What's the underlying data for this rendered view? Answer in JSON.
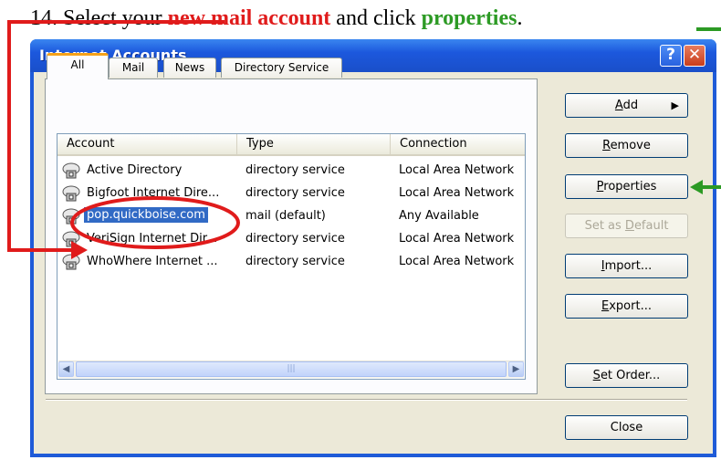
{
  "caption": {
    "prefix": "14. Select your ",
    "highlight1": "new mail account",
    "middle": " and click ",
    "highlight2": "properties",
    "suffix": "."
  },
  "window": {
    "title": "Internet Accounts",
    "help_glyph": "?",
    "close_glyph": "✕"
  },
  "tabs": [
    "All",
    "Mail",
    "News",
    "Directory Service"
  ],
  "columns": [
    "Account",
    "Type",
    "Connection"
  ],
  "accounts": [
    {
      "name": "Active Directory",
      "type": "directory service",
      "connection": "Local Area Network"
    },
    {
      "name": "Bigfoot Internet Dire...",
      "type": "directory service",
      "connection": "Local Area Network"
    },
    {
      "name": "pop.quickboise.com",
      "type": "mail (default)",
      "connection": "Any Available"
    },
    {
      "name": "VeriSign Internet Dir...",
      "type": "directory service",
      "connection": "Local Area Network"
    },
    {
      "name": "WhoWhere Internet ...",
      "type": "directory service",
      "connection": "Local Area Network"
    }
  ],
  "selected_account": "pop.quickboise.com",
  "buttons": {
    "add": {
      "mnemonic": "A",
      "rest": "dd"
    },
    "remove": {
      "mnemonic": "R",
      "rest": "emove"
    },
    "properties": {
      "mnemonic": "P",
      "rest": "roperties"
    },
    "set_default": {
      "before": "Set as ",
      "mnemonic": "D",
      "rest": "efault"
    },
    "import": {
      "mnemonic": "I",
      "rest": "mport..."
    },
    "export": {
      "mnemonic": "E",
      "rest": "xport..."
    },
    "set_order": {
      "mnemonic": "S",
      "rest": "et Order..."
    },
    "close": "Close"
  },
  "icons": {
    "account": "address-book-icon",
    "scroll_left": "arrow-left-icon",
    "scroll_right": "arrow-right-icon",
    "add_submenu": "triangle-right-icon"
  },
  "colors": {
    "highlight_red": "#e01b1b",
    "highlight_green": "#2c9a24",
    "selection": "#316ac5",
    "title_bar": "#1f5bd8"
  }
}
